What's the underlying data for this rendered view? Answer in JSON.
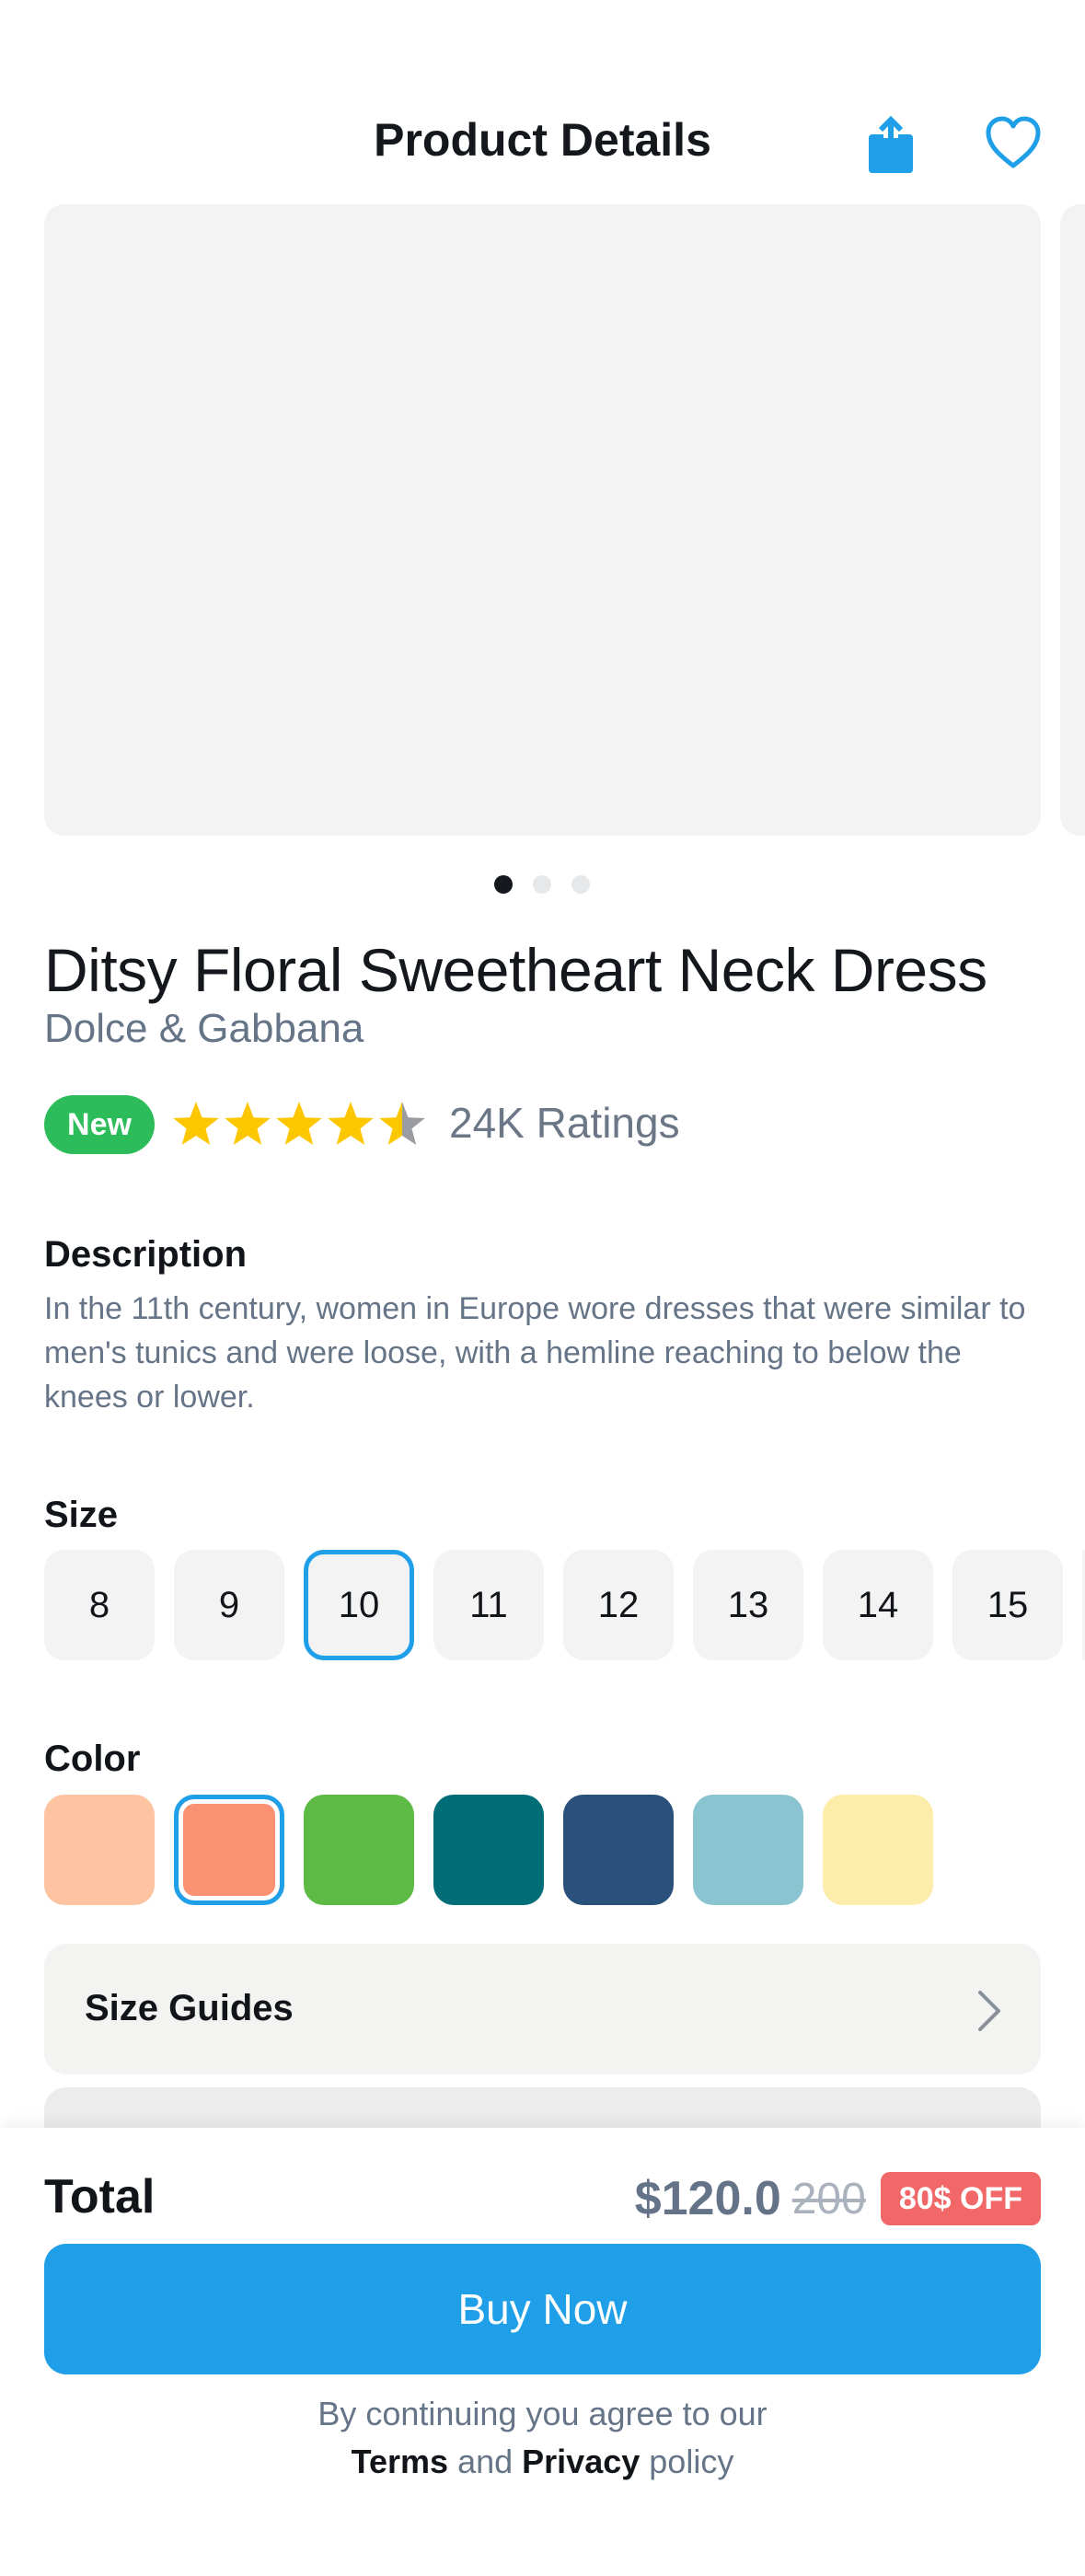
{
  "header": {
    "title": "Product Details",
    "share_icon": "share-icon",
    "favorite_icon": "heart-icon"
  },
  "carousel": {
    "total_slides": 3,
    "active_index": 0
  },
  "product": {
    "title": "Ditsy Floral Sweetheart Neck Dress",
    "brand": "Dolce & Gabbana",
    "badge": "New",
    "rating": 4.5,
    "rating_max": 5,
    "ratings_count": "24K Ratings"
  },
  "description": {
    "label": "Description",
    "text": "In the 11th century, women in Europe wore dresses that were similar to men's tunics and were loose, with a hemline reaching to below the knees or lower."
  },
  "size": {
    "label": "Size",
    "options": [
      "8",
      "9",
      "10",
      "11",
      "12",
      "13",
      "14",
      "15"
    ],
    "selected": "10"
  },
  "color": {
    "label": "Color",
    "options": [
      "#fec3a0",
      "#f99172",
      "#5dba45",
      "#016d77",
      "#29517b",
      "#8ac4d0",
      "#fcedaa"
    ],
    "selected_index": 1
  },
  "size_guides": {
    "label": "Size Guides"
  },
  "checkout": {
    "total_label": "Total",
    "price": "$120.0",
    "original_price": "200",
    "discount": "80$ OFF",
    "buy_label": "Buy Now",
    "consent_line1": "By continuing you agree to our",
    "terms": "Terms",
    "and": "and",
    "privacy": "Privacy",
    "policy": "policy"
  },
  "colors": {
    "accent": "#209fe9",
    "new_badge": "#2cbd5a",
    "star": "#fdc700",
    "discount": "#f26768",
    "muted_text": "#657487"
  }
}
